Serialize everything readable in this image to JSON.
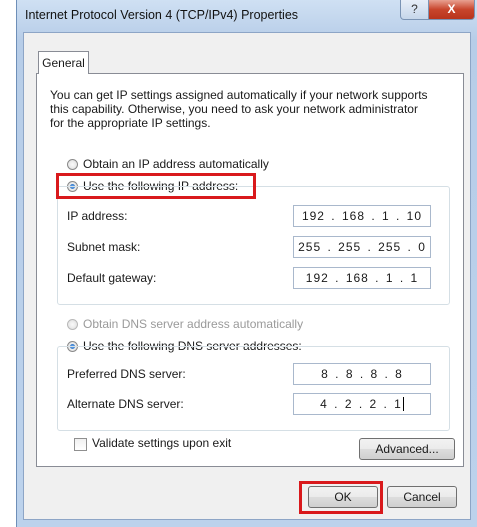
{
  "window": {
    "title": "Internet Protocol Version 4 (TCP/IPv4) Properties",
    "help_glyph": "?",
    "close_glyph": "X"
  },
  "tab": {
    "label": "General"
  },
  "intro_text": "You can get IP settings assigned automatically if your network supports\nthis capability. Otherwise, you need to ask your network administrator\nfor the appropriate IP settings.",
  "ip_mode": {
    "auto_label": "Obtain an IP address automatically",
    "manual_label": "Use the following IP address:",
    "selected": "manual"
  },
  "ip_fields": {
    "ip_label": "IP address:",
    "ip_value": "192 . 168 . 1 . 10",
    "subnet_label": "Subnet mask:",
    "subnet_value": "255 . 255 . 255 . 0",
    "gateway_label": "Default gateway:",
    "gateway_value": "192 . 168 . 1 . 1"
  },
  "dns_mode": {
    "auto_label": "Obtain DNS server address automatically",
    "manual_label": "Use the following DNS server addresses:",
    "selected": "manual"
  },
  "dns_fields": {
    "preferred_label": "Preferred DNS server:",
    "preferred_value": "8 . 8 . 8 . 8",
    "alternate_label": "Alternate DNS server:",
    "alternate_value": "4 . 2 . 2 . 1"
  },
  "validate_label": "Validate settings upon exit",
  "buttons": {
    "advanced": "Advanced...",
    "ok": "OK",
    "cancel": "Cancel"
  },
  "colors": {
    "highlight": "#d9191c"
  }
}
